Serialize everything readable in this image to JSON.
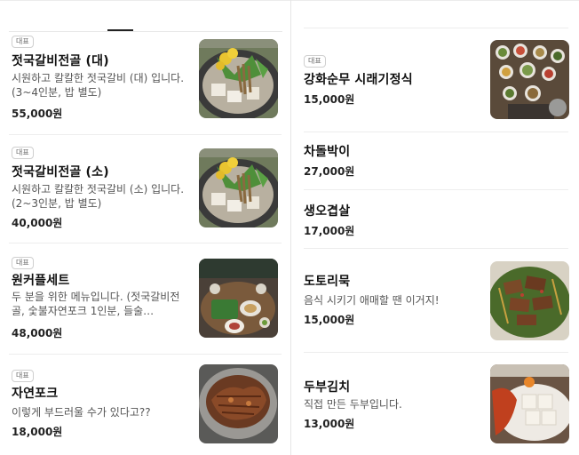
{
  "left": {
    "items": [
      {
        "badge": "대표",
        "name": "젓국갈비전골 (대)",
        "desc": "시원하고 칼칼한 젓국갈비 (대) 입니다. (3~4인분, 밥 별도)",
        "price": "55,000원",
        "image": "hotpot-photo"
      },
      {
        "badge": "대표",
        "name": "젓국갈비전골 (소)",
        "desc": "시원하고 칼칼한 젓국갈비 (소) 입니다. (2~3인분, 밥 별도)",
        "price": "40,000원",
        "image": "hotpot-photo"
      },
      {
        "badge": "대표",
        "name": "원커플세트",
        "desc": "두 분을 위한 메뉴입니다. (젓국갈비전골, 숯불자연포크 1인분, 들술…",
        "price": "48,000원",
        "image": "set-meal-photo"
      },
      {
        "badge": "대표",
        "name": "자연포크",
        "desc": "이렇게 부드러울 수가 있다고??",
        "price": "18,000원",
        "image": "grilled-pork-photo"
      }
    ]
  },
  "right": {
    "items": [
      {
        "badge": "대표",
        "name": "강화순무 시래기정식",
        "desc": "",
        "price": "15,000원",
        "image": "side-dishes-photo"
      },
      {
        "badge": "",
        "name": "차돌박이",
        "desc": "",
        "price": "27,000원",
        "image": ""
      },
      {
        "badge": "",
        "name": "생오겹살",
        "desc": "",
        "price": "17,000원",
        "image": ""
      },
      {
        "badge": "",
        "name": "도토리묵",
        "desc": "음식 시키기 애매할 땐 이거지!",
        "price": "15,000원",
        "image": "acorn-jelly-photo"
      },
      {
        "badge": "",
        "name": "두부김치",
        "desc": "직접 만든 두부입니다.",
        "price": "13,000원",
        "image": "tofu-kimchi-photo"
      }
    ]
  }
}
